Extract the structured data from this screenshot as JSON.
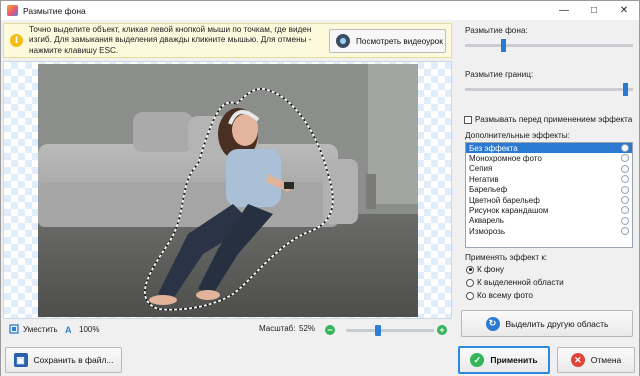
{
  "window": {
    "title": "Размытие фона"
  },
  "hint": {
    "text": "Точно выделите объект, кликая левой кнопкой мыши по точкам, где виден изгиб. Для замыкания выделения дважды кликните мышью. Для отмены - нажмите клавишу ESC.",
    "video_button": "Посмотреть видеоурок"
  },
  "statusbar": {
    "fit_label": "Уместить",
    "percent_label": "100%",
    "scale_label": "Масштаб:",
    "scale_value": "52%",
    "scale_fraction": 0.35
  },
  "panel": {
    "bg_blur_label": "Размытие фона:",
    "bg_blur_level": 0.22,
    "edge_blur_label": "Размытие границ:",
    "edge_blur_level": 0.97,
    "blur_before_apply": "Размывать перед применением эффекта",
    "extra_effects_label": "Дополнительные эффекты:",
    "effects": [
      "Без эффекта",
      "Монохромное фото",
      "Сепия",
      "Негатив",
      "Барельеф",
      "Цветной барельеф",
      "Рисунок карандашом",
      "Акварель",
      "Изморозь"
    ],
    "selected_effect_index": 0,
    "apply_to_label": "Применять эффект к:",
    "apply_options": [
      "К фону",
      "К выделенной области",
      "Ко всему фото"
    ],
    "apply_selected_index": 0,
    "select_other_button": "Выделить другую область"
  },
  "bottom": {
    "save_button": "Сохранить в файл...",
    "apply_button": "Применить",
    "cancel_button": "Отмена"
  },
  "colors": {
    "accent": "#2a7ad2",
    "ok_green": "#35b45a",
    "cancel_red": "#e0453a",
    "hint_bg": "#fdf9dc"
  }
}
